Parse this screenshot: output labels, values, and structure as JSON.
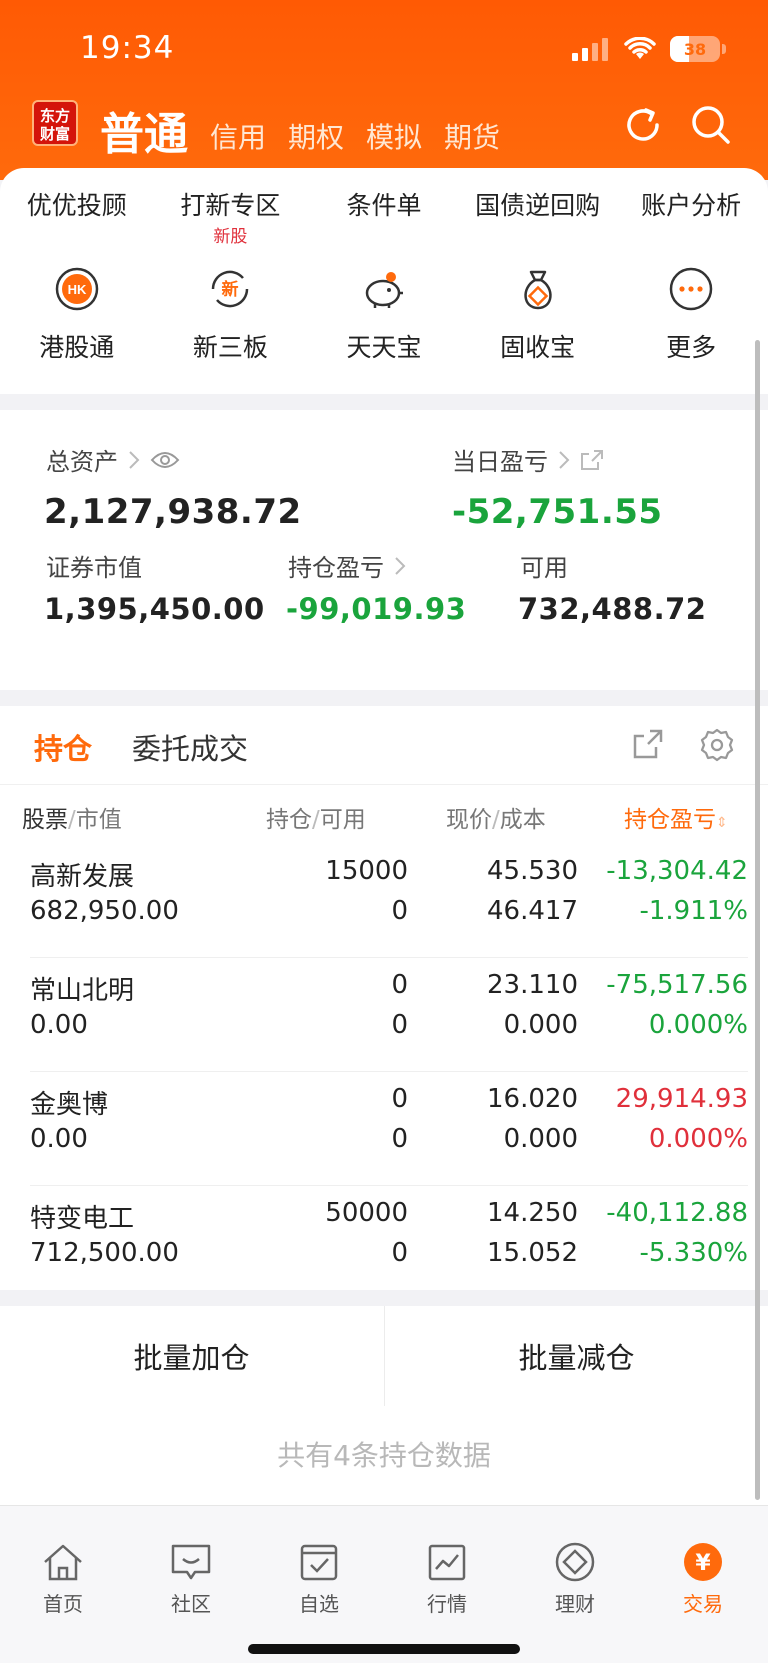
{
  "status": {
    "time": "19:34",
    "battery": "38"
  },
  "header": {
    "logo_line1": "东方",
    "logo_line2": "财富",
    "active_tab": "普通",
    "tabs": [
      "信用",
      "期权",
      "模拟",
      "期货"
    ]
  },
  "quick_row1": [
    {
      "label": "优优投顾"
    },
    {
      "label": "打新专区",
      "badge": "新股"
    },
    {
      "label": "条件单"
    },
    {
      "label": "国债逆回购"
    },
    {
      "label": "账户分析"
    }
  ],
  "quick_row2": [
    {
      "label": "港股通",
      "icon": "hk-icon",
      "icon_text": "HK"
    },
    {
      "label": "新三板",
      "icon": "xin-icon",
      "icon_text": "新"
    },
    {
      "label": "天天宝",
      "icon": "piggy-bank-icon"
    },
    {
      "label": "固收宝",
      "icon": "money-bag-icon"
    },
    {
      "label": "更多",
      "icon": "more-icon"
    }
  ],
  "assets": {
    "total_label": "总资产",
    "total_value": "2,127,938.72",
    "daily_label": "当日盈亏",
    "daily_value": "-52,751.55",
    "market_label": "证券市值",
    "market_value": "1,395,450.00",
    "position_pl_label": "持仓盈亏",
    "position_pl_value": "-99,019.93",
    "available_label": "可用",
    "available_value": "732,488.72"
  },
  "position_tabs": {
    "active": "持仓",
    "other": "委托成交"
  },
  "columns": {
    "stock": "股票",
    "market_value": "市值",
    "hold": "持仓",
    "avail": "可用",
    "price": "现价",
    "cost": "成本",
    "pl": "持仓盈亏"
  },
  "positions": [
    {
      "name": "高新发展",
      "market_value": "682,950.00",
      "hold": "15000",
      "avail": "0",
      "price": "45.530",
      "cost": "46.417",
      "pl": "-13,304.42",
      "pl_pct": "-1.911%",
      "color": "#1aa43c"
    },
    {
      "name": "常山北明",
      "market_value": "0.00",
      "hold": "0",
      "avail": "0",
      "price": "23.110",
      "cost": "0.000",
      "pl": "-75,517.56",
      "pl_pct": "0.000%",
      "color": "#1aa43c"
    },
    {
      "name": "金奥博",
      "market_value": "0.00",
      "hold": "0",
      "avail": "0",
      "price": "16.020",
      "cost": "0.000",
      "pl": "29,914.93",
      "pl_pct": "0.000%",
      "color": "#e0303b"
    },
    {
      "name": "特变电工",
      "market_value": "712,500.00",
      "hold": "50000",
      "avail": "0",
      "price": "14.250",
      "cost": "15.052",
      "pl": "-40,112.88",
      "pl_pct": "-5.330%",
      "color": "#1aa43c"
    }
  ],
  "batch": {
    "add": "批量加仓",
    "reduce": "批量减仓"
  },
  "footer_note": "共有4条持仓数据",
  "nav": [
    {
      "label": "首页",
      "icon": "home-icon"
    },
    {
      "label": "社区",
      "icon": "community-icon"
    },
    {
      "label": "自选",
      "icon": "watchlist-icon"
    },
    {
      "label": "行情",
      "icon": "market-icon"
    },
    {
      "label": "理财",
      "icon": "wealth-icon"
    },
    {
      "label": "交易",
      "icon": "trade-icon",
      "icon_text": "¥"
    }
  ],
  "colors": {
    "accent": "#ff6a0c",
    "up": "#e0303b",
    "down": "#1aa43c"
  }
}
